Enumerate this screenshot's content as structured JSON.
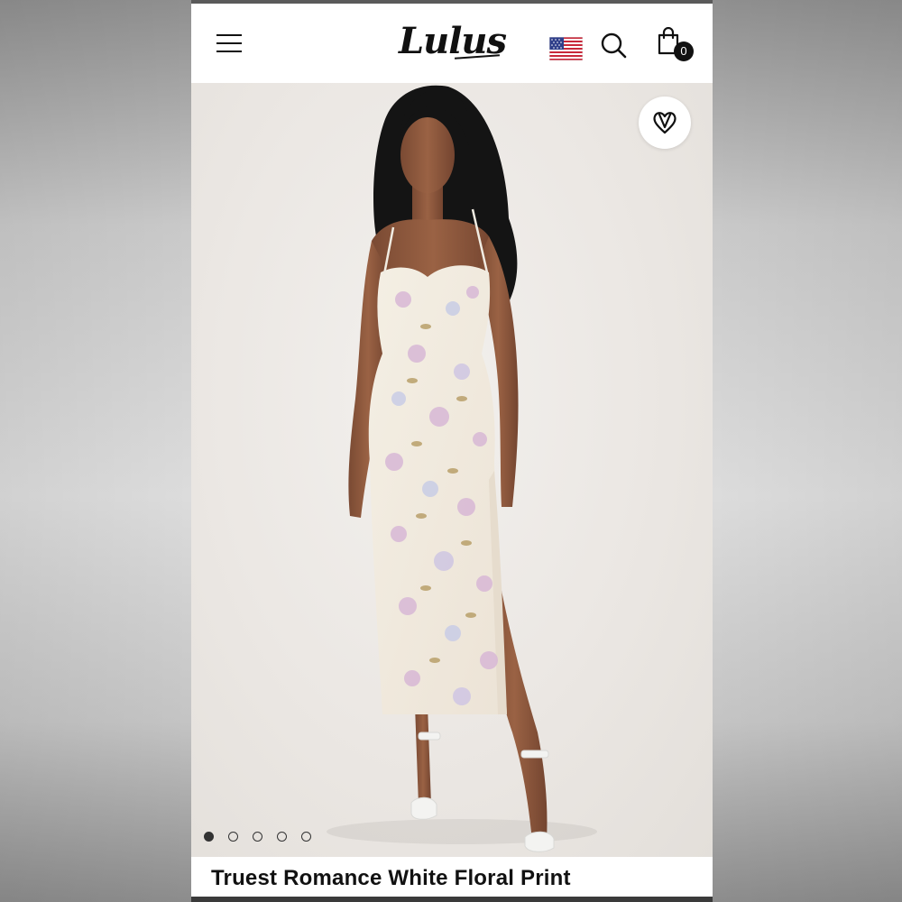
{
  "header": {
    "logo_text": "Lulus",
    "menu_icon": "hamburger-menu-icon",
    "flag_icon": "us-flag-icon",
    "search_icon": "search-icon",
    "bag_icon": "shopping-bag-icon",
    "bag_count": "0"
  },
  "gallery": {
    "wishlist_icon": "heart-icon",
    "image_description_icon": "product-photo",
    "total_images": 5,
    "active_index": 0
  },
  "product": {
    "title": "Truest Romance White Floral Print"
  },
  "colors": {
    "background": "#ebe7e3",
    "text": "#111111",
    "badge": "#111111"
  }
}
